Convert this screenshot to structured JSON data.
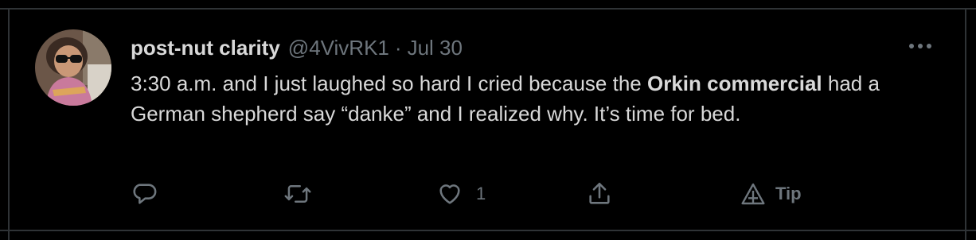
{
  "tweet": {
    "display_name": "post-nut clarity",
    "handle": "@4VivRK1",
    "separator": "·",
    "date": "Jul 30",
    "text_segments": [
      "3:30 a.m. and I just laughed so hard I cried because the ",
      "Orkin commercial",
      " had a German shepherd say “danke” and I realized why. It’s time for bed."
    ]
  },
  "actions": {
    "reply_icon": "reply-icon",
    "retweet_icon": "retweet-icon",
    "like_icon": "heart-icon",
    "like_count": "1",
    "share_icon": "share-icon",
    "tip_icon": "tip-icon",
    "tip_label": "Tip"
  },
  "colors": {
    "background": "#000000",
    "text": "#d9d9d9",
    "muted": "#6e767d",
    "border": "#2f3336"
  }
}
